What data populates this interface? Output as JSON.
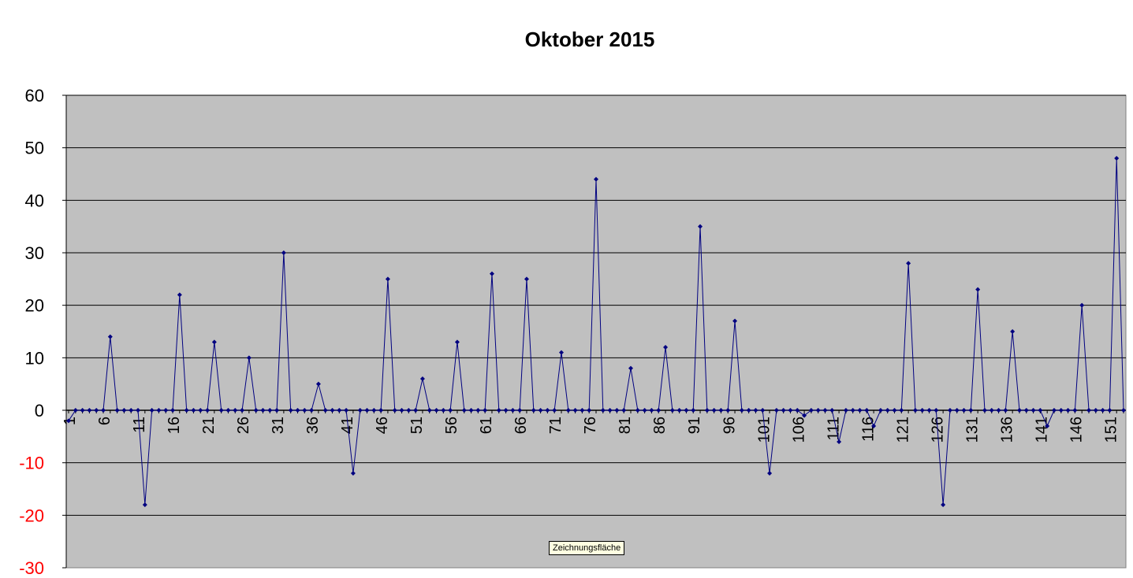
{
  "chart_data": {
    "type": "line",
    "title": "Oktober 2015",
    "xlabel": "",
    "ylabel": "",
    "ylim": [
      -30,
      60
    ],
    "yticks": [
      60,
      50,
      40,
      30,
      20,
      10,
      0,
      -10,
      -20,
      -30
    ],
    "x_first": 1,
    "x_tick_step": 5,
    "grid": true,
    "legend": "none",
    "colors": {
      "plot_background": "#c0c0c0",
      "line": "#000080",
      "marker": "#000080",
      "gridline": "#000000",
      "negative_tick_label": "#ff0000",
      "positive_tick_label": "#000000"
    },
    "series": [
      {
        "values": [
          -2,
          0,
          0,
          0,
          0,
          0,
          14,
          0,
          0,
          0,
          0,
          -18,
          0,
          0,
          0,
          0,
          22,
          0,
          0,
          0,
          0,
          13,
          0,
          0,
          0,
          0,
          10,
          0,
          0,
          0,
          0,
          30,
          0,
          0,
          0,
          0,
          5,
          0,
          0,
          0,
          0,
          -12,
          0,
          0,
          0,
          0,
          25,
          0,
          0,
          0,
          0,
          6,
          0,
          0,
          0,
          0,
          13,
          0,
          0,
          0,
          0,
          26,
          0,
          0,
          0,
          0,
          25,
          0,
          0,
          0,
          0,
          11,
          0,
          0,
          0,
          0,
          44,
          0,
          0,
          0,
          0,
          8,
          0,
          0,
          0,
          0,
          12,
          0,
          0,
          0,
          0,
          35,
          0,
          0,
          0,
          0,
          17,
          0,
          0,
          0,
          0,
          -12,
          0,
          0,
          0,
          0,
          -1,
          0,
          0,
          0,
          0,
          -6,
          0,
          0,
          0,
          0,
          -3,
          0,
          0,
          0,
          0,
          28,
          0,
          0,
          0,
          0,
          -18,
          0,
          0,
          0,
          0,
          23,
          0,
          0,
          0,
          0,
          15,
          0,
          0,
          0,
          0,
          -3,
          0,
          0,
          0,
          0,
          20,
          0,
          0,
          0,
          0,
          48,
          0
        ]
      }
    ]
  },
  "tooltip": "Zeichnungsfläche"
}
